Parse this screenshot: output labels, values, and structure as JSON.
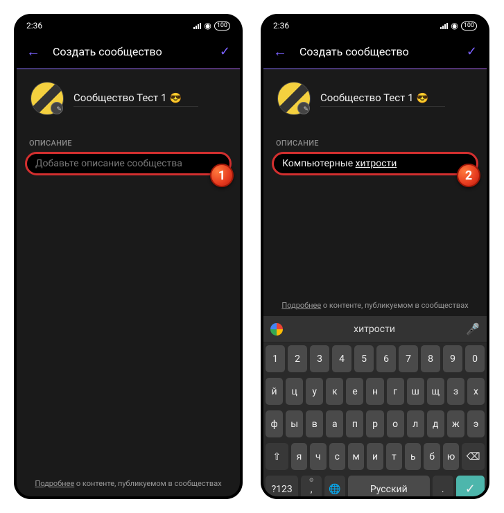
{
  "left": {
    "status_time": "2:36",
    "battery": "100",
    "title": "Создать сообщество",
    "community_name": "Сообщество Тест 1",
    "emoji": "😎",
    "description_label": "ОПИСАНИЕ",
    "description_placeholder": "Добавьте описание сообщества",
    "badge": "1",
    "footer_link": "Подробнее",
    "footer_rest": " о контенте, публикуемом в сообществах"
  },
  "right": {
    "status_time": "2:36",
    "battery": "100",
    "title": "Создать сообщество",
    "community_name": "Сообщество Тест 1",
    "emoji": "😎",
    "description_label": "ОПИСАНИЕ",
    "description_pre": "Компьютерные ",
    "description_word": "хитрости",
    "badge": "2",
    "footer_link": "Подробнее",
    "footer_rest": " о контенте, публикуемом в сообществах",
    "keyboard": {
      "suggestion": "хитрости",
      "row1": [
        "1",
        "2",
        "3",
        "4",
        "5",
        "6",
        "7",
        "8",
        "9",
        "0"
      ],
      "row2": [
        "й",
        "ц",
        "у",
        "к",
        "е",
        "н",
        "г",
        "ш",
        "щ",
        "з",
        "х"
      ],
      "row3": [
        "ф",
        "ы",
        "в",
        "а",
        "п",
        "р",
        "о",
        "л",
        "д",
        "ж",
        "э"
      ],
      "row4_shift": "⇧",
      "row4": [
        "я",
        "ч",
        "с",
        "м",
        "и",
        "т",
        "ь",
        "б",
        "ю"
      ],
      "row4_back": "⌫",
      "sym": "?123",
      "comma": ",",
      "globe": "🌐",
      "space": "Русский",
      "dot": ".",
      "enter": "✓"
    }
  }
}
